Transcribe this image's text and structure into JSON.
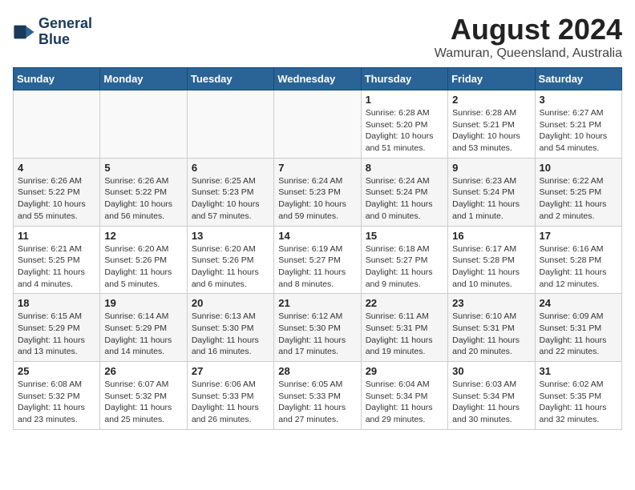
{
  "header": {
    "logo_line1": "General",
    "logo_line2": "Blue",
    "title": "August 2024",
    "subtitle": "Wamuran, Queensland, Australia"
  },
  "weekdays": [
    "Sunday",
    "Monday",
    "Tuesday",
    "Wednesday",
    "Thursday",
    "Friday",
    "Saturday"
  ],
  "weeks": [
    [
      {
        "day": "",
        "info": ""
      },
      {
        "day": "",
        "info": ""
      },
      {
        "day": "",
        "info": ""
      },
      {
        "day": "",
        "info": ""
      },
      {
        "day": "1",
        "info": "Sunrise: 6:28 AM\nSunset: 5:20 PM\nDaylight: 10 hours and 51 minutes."
      },
      {
        "day": "2",
        "info": "Sunrise: 6:28 AM\nSunset: 5:21 PM\nDaylight: 10 hours and 53 minutes."
      },
      {
        "day": "3",
        "info": "Sunrise: 6:27 AM\nSunset: 5:21 PM\nDaylight: 10 hours and 54 minutes."
      }
    ],
    [
      {
        "day": "4",
        "info": "Sunrise: 6:26 AM\nSunset: 5:22 PM\nDaylight: 10 hours and 55 minutes."
      },
      {
        "day": "5",
        "info": "Sunrise: 6:26 AM\nSunset: 5:22 PM\nDaylight: 10 hours and 56 minutes."
      },
      {
        "day": "6",
        "info": "Sunrise: 6:25 AM\nSunset: 5:23 PM\nDaylight: 10 hours and 57 minutes."
      },
      {
        "day": "7",
        "info": "Sunrise: 6:24 AM\nSunset: 5:23 PM\nDaylight: 10 hours and 59 minutes."
      },
      {
        "day": "8",
        "info": "Sunrise: 6:24 AM\nSunset: 5:24 PM\nDaylight: 11 hours and 0 minutes."
      },
      {
        "day": "9",
        "info": "Sunrise: 6:23 AM\nSunset: 5:24 PM\nDaylight: 11 hours and 1 minute."
      },
      {
        "day": "10",
        "info": "Sunrise: 6:22 AM\nSunset: 5:25 PM\nDaylight: 11 hours and 2 minutes."
      }
    ],
    [
      {
        "day": "11",
        "info": "Sunrise: 6:21 AM\nSunset: 5:25 PM\nDaylight: 11 hours and 4 minutes."
      },
      {
        "day": "12",
        "info": "Sunrise: 6:20 AM\nSunset: 5:26 PM\nDaylight: 11 hours and 5 minutes."
      },
      {
        "day": "13",
        "info": "Sunrise: 6:20 AM\nSunset: 5:26 PM\nDaylight: 11 hours and 6 minutes."
      },
      {
        "day": "14",
        "info": "Sunrise: 6:19 AM\nSunset: 5:27 PM\nDaylight: 11 hours and 8 minutes."
      },
      {
        "day": "15",
        "info": "Sunrise: 6:18 AM\nSunset: 5:27 PM\nDaylight: 11 hours and 9 minutes."
      },
      {
        "day": "16",
        "info": "Sunrise: 6:17 AM\nSunset: 5:28 PM\nDaylight: 11 hours and 10 minutes."
      },
      {
        "day": "17",
        "info": "Sunrise: 6:16 AM\nSunset: 5:28 PM\nDaylight: 11 hours and 12 minutes."
      }
    ],
    [
      {
        "day": "18",
        "info": "Sunrise: 6:15 AM\nSunset: 5:29 PM\nDaylight: 11 hours and 13 minutes."
      },
      {
        "day": "19",
        "info": "Sunrise: 6:14 AM\nSunset: 5:29 PM\nDaylight: 11 hours and 14 minutes."
      },
      {
        "day": "20",
        "info": "Sunrise: 6:13 AM\nSunset: 5:30 PM\nDaylight: 11 hours and 16 minutes."
      },
      {
        "day": "21",
        "info": "Sunrise: 6:12 AM\nSunset: 5:30 PM\nDaylight: 11 hours and 17 minutes."
      },
      {
        "day": "22",
        "info": "Sunrise: 6:11 AM\nSunset: 5:31 PM\nDaylight: 11 hours and 19 minutes."
      },
      {
        "day": "23",
        "info": "Sunrise: 6:10 AM\nSunset: 5:31 PM\nDaylight: 11 hours and 20 minutes."
      },
      {
        "day": "24",
        "info": "Sunrise: 6:09 AM\nSunset: 5:31 PM\nDaylight: 11 hours and 22 minutes."
      }
    ],
    [
      {
        "day": "25",
        "info": "Sunrise: 6:08 AM\nSunset: 5:32 PM\nDaylight: 11 hours and 23 minutes."
      },
      {
        "day": "26",
        "info": "Sunrise: 6:07 AM\nSunset: 5:32 PM\nDaylight: 11 hours and 25 minutes."
      },
      {
        "day": "27",
        "info": "Sunrise: 6:06 AM\nSunset: 5:33 PM\nDaylight: 11 hours and 26 minutes."
      },
      {
        "day": "28",
        "info": "Sunrise: 6:05 AM\nSunset: 5:33 PM\nDaylight: 11 hours and 27 minutes."
      },
      {
        "day": "29",
        "info": "Sunrise: 6:04 AM\nSunset: 5:34 PM\nDaylight: 11 hours and 29 minutes."
      },
      {
        "day": "30",
        "info": "Sunrise: 6:03 AM\nSunset: 5:34 PM\nDaylight: 11 hours and 30 minutes."
      },
      {
        "day": "31",
        "info": "Sunrise: 6:02 AM\nSunset: 5:35 PM\nDaylight: 11 hours and 32 minutes."
      }
    ]
  ]
}
